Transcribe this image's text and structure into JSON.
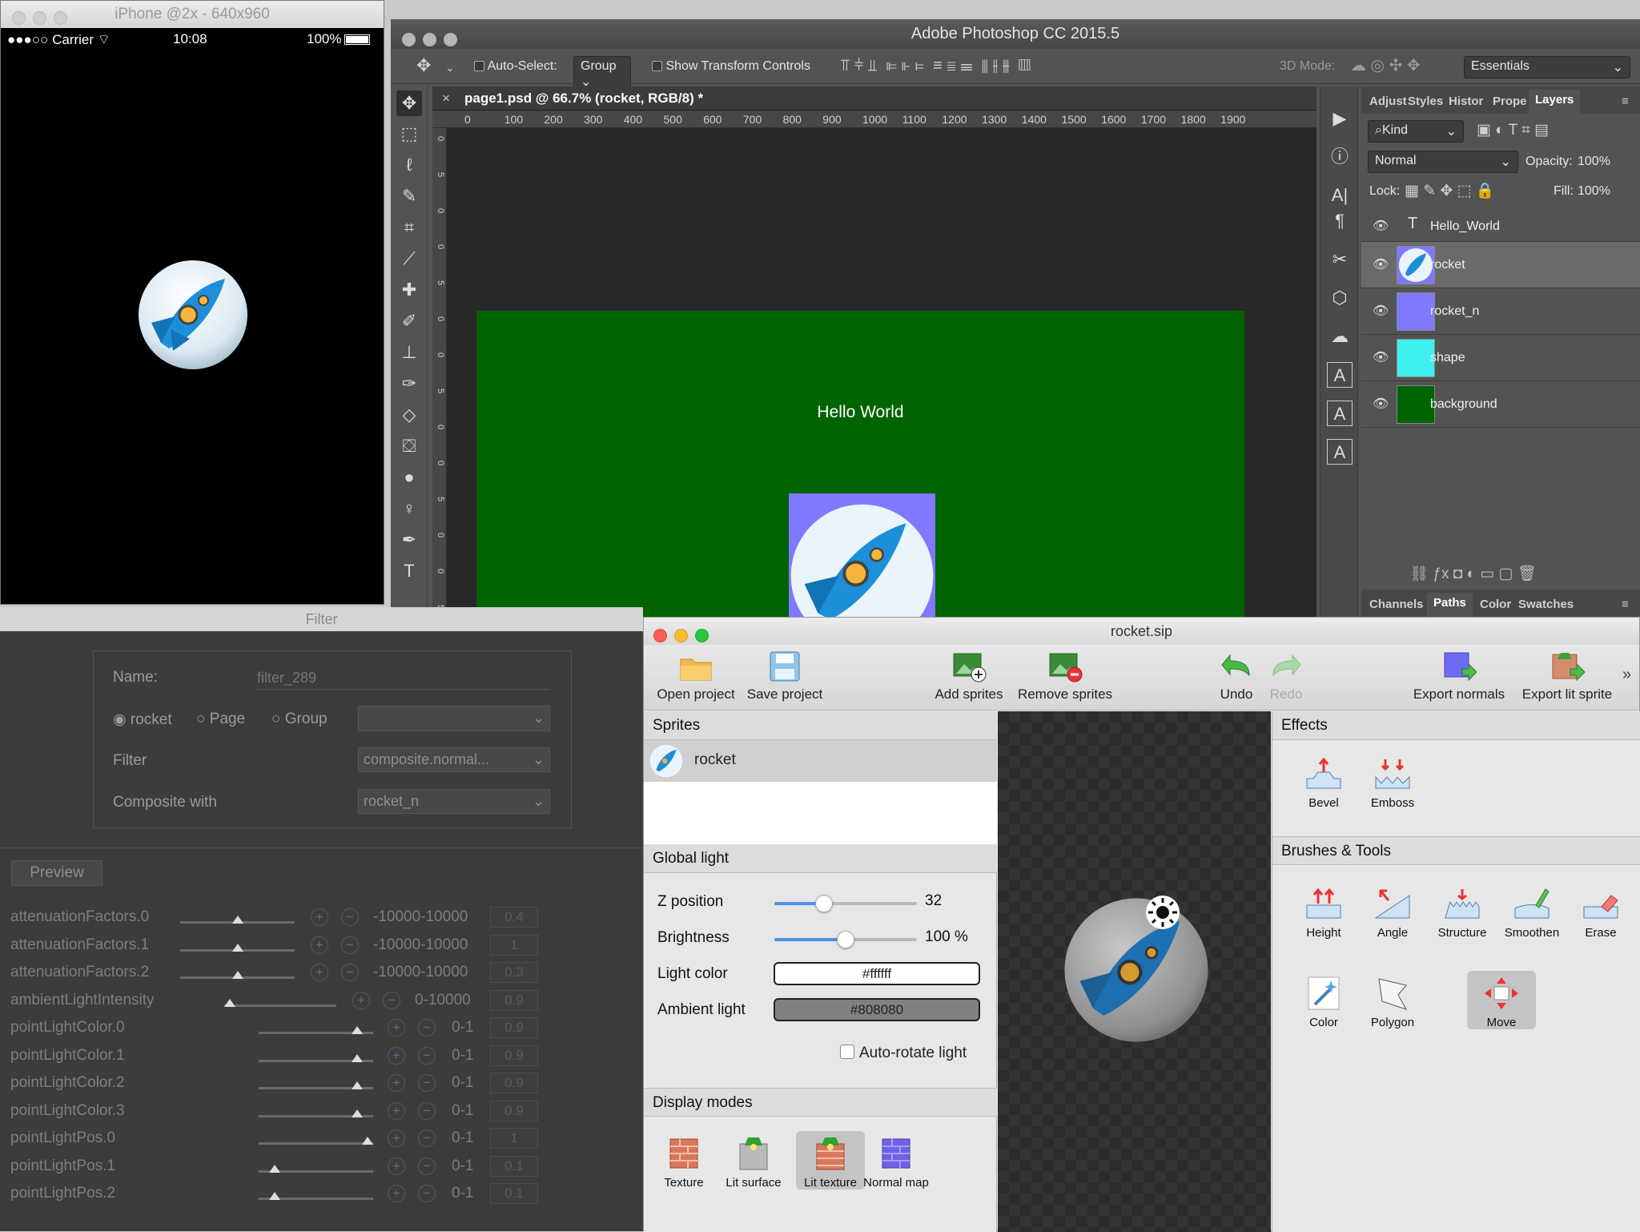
{
  "iphone": {
    "title": "iPhone @2x - 640x960",
    "carrier": "●●●○○ Carrier",
    "time": "10:08",
    "battery": "100%",
    "battery_level": 1.0
  },
  "photoshop": {
    "title": "Adobe Photoshop CC 2015.5",
    "options": {
      "auto_select_label": "Auto-Select:",
      "auto_select_value": "Group",
      "show_transform_label": "Show Transform Controls",
      "mode_3d_label": "3D Mode:",
      "workspace": "Essentials"
    },
    "document_tab": "page1.psd @ 66.7% (rocket, RGB/8) *",
    "ruler_ticks": [
      "0",
      "100",
      "200",
      "300",
      "400",
      "500",
      "600",
      "700",
      "800",
      "900",
      "1000",
      "1100",
      "1200",
      "1300",
      "1400",
      "1500",
      "1600",
      "1700",
      "1800",
      "1900"
    ],
    "ruler_v_ticks": [
      "0",
      "5",
      "0",
      "0",
      "5",
      "0",
      "0",
      "5",
      "0",
      "0",
      "5",
      "0",
      "0",
      "5"
    ],
    "canvas_text": "Hello World",
    "panel_tabs": [
      "Adjust",
      "Styles",
      "Histor",
      "Prope",
      "Layers"
    ],
    "kind_label": "Kind",
    "blend_mode": "Normal",
    "opacity_label": "Opacity:",
    "opacity_value": "100%",
    "lock_label": "Lock:",
    "fill_label": "Fill:",
    "fill_value": "100%",
    "layers": [
      {
        "name": "Hello_World",
        "type": "text"
      },
      {
        "name": "rocket",
        "type": "smart",
        "selected": true
      },
      {
        "name": "rocket_n",
        "type": "smart"
      },
      {
        "name": "shape",
        "type": "shape"
      },
      {
        "name": "background",
        "type": "fill",
        "color": "#006400"
      }
    ],
    "bottom_tabs": [
      "Channels",
      "Paths",
      "Color",
      "Swatches"
    ]
  },
  "filter": {
    "title": "Filter",
    "name_label": "Name:",
    "name_placeholder": "filter_289",
    "scope_options": [
      "rocket",
      "Page",
      "Group"
    ],
    "filter_label": "Filter",
    "filter_value": "composite.normal...",
    "composite_label": "Composite with",
    "composite_value": "rocket_n",
    "preview_button": "Preview",
    "params": [
      {
        "name": "attenuationFactors.0",
        "range": "-10000-10000",
        "value": "0.4",
        "level": 0.5
      },
      {
        "name": "attenuationFactors.1",
        "range": "-10000-10000",
        "value": "1",
        "level": 0.5
      },
      {
        "name": "attenuationFactors.2",
        "range": "-10000-10000",
        "value": "0.3",
        "level": 0.5
      },
      {
        "name": "ambientLightIntensity",
        "range": "0-10000",
        "value": "0.9",
        "level": 0.0
      },
      {
        "name": "pointLightColor.0",
        "range": "0-1",
        "value": "0.9",
        "level": 0.9
      },
      {
        "name": "pointLightColor.1",
        "range": "0-1",
        "value": "0.9",
        "level": 0.9
      },
      {
        "name": "pointLightColor.2",
        "range": "0-1",
        "value": "0.9",
        "level": 0.9
      },
      {
        "name": "pointLightColor.3",
        "range": "0-1",
        "value": "0.9",
        "level": 0.9
      },
      {
        "name": "pointLightPos.0",
        "range": "0-1",
        "value": "1",
        "level": 1.0
      },
      {
        "name": "pointLightPos.1",
        "range": "0-1",
        "value": "0.1",
        "level": 0.1
      },
      {
        "name": "pointLightPos.2",
        "range": "0-1",
        "value": "0.1",
        "level": 0.1
      }
    ]
  },
  "sip": {
    "title": "rocket.sip",
    "toolbar": {
      "open": "Open project",
      "save": "Save project",
      "add": "Add sprites",
      "remove": "Remove sprites",
      "undo": "Undo",
      "redo": "Redo",
      "export_normals": "Export normals",
      "export_lit": "Export lit sprite",
      "more": "»"
    },
    "sprites_header": "Sprites",
    "sprite_name": "rocket",
    "global_light_header": "Global light",
    "z_position_label": "Z position",
    "z_position_value": "32",
    "z_level": 0.35,
    "brightness_label": "Brightness",
    "brightness_value": "100 %",
    "brightness_level": 0.5,
    "light_color_label": "Light color",
    "light_color": "#ffffff",
    "ambient_label": "Ambient light",
    "ambient_color": "#808080",
    "auto_rotate_label": "Auto-rotate light",
    "display_modes_header": "Display modes",
    "display_modes": [
      {
        "label": "Texture"
      },
      {
        "label": "Lit surface"
      },
      {
        "label": "Lit texture",
        "selected": true
      },
      {
        "label": "Normal map"
      }
    ],
    "effects_header": "Effects",
    "effects": [
      "Bevel",
      "Emboss"
    ],
    "brushes_header": "Brushes & Tools",
    "brushes": [
      "Height",
      "Angle",
      "Structure",
      "Smoothen",
      "Erase"
    ],
    "tools": [
      "Color",
      "Polygon",
      "Move"
    ],
    "selected_tool": "Move"
  }
}
